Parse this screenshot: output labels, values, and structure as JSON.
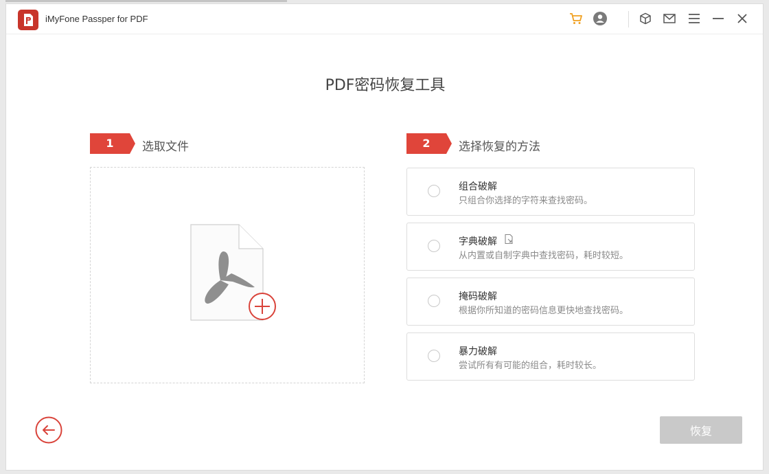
{
  "window": {
    "title": "iMyFone Passper for PDF"
  },
  "titlebar": {
    "icons": [
      "cart-icon",
      "account-icon",
      "box-icon",
      "mail-icon",
      "menu-icon",
      "minimize-icon",
      "close-icon"
    ]
  },
  "page": {
    "title": "PDF密码恢复工具"
  },
  "step1": {
    "number": "1",
    "label": "选取文件"
  },
  "step2": {
    "number": "2",
    "label": "选择恢复的方法"
  },
  "methods": [
    {
      "title": "组合破解",
      "desc": "只组合你选择的字符来查找密码。"
    },
    {
      "title": "字典破解",
      "desc": "从内置或自制字典中查找密码，耗时较短。"
    },
    {
      "title": "掩码破解",
      "desc": "根据你所知道的密码信息更快地查找密码。"
    },
    {
      "title": "暴力破解",
      "desc": "尝试所有有可能的组合，耗时较长。"
    }
  ],
  "actions": {
    "recover_label": "恢复"
  },
  "colors": {
    "accent": "#e0453a",
    "accent_dark": "#c8352b",
    "disabled_button": "#c9c9c9",
    "cart": "#f0a020"
  }
}
